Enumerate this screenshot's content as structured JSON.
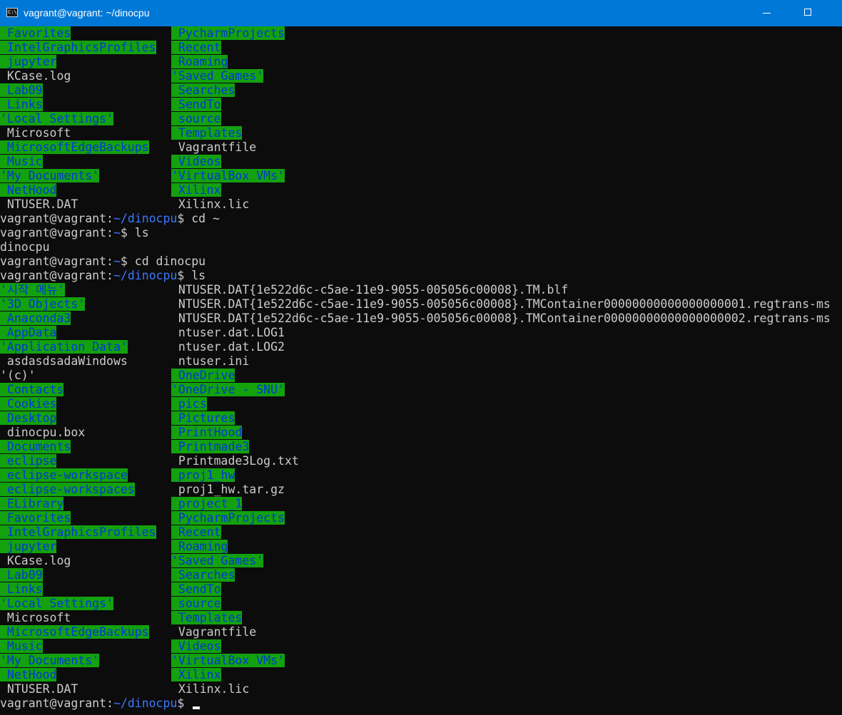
{
  "window": {
    "title": "vagrant@vagrant: ~/dinocpu",
    "icon": "command-prompt-icon",
    "icon_text": "C:\\",
    "controls": [
      "minimize-icon",
      "maximize-icon"
    ]
  },
  "colors": {
    "background": "#0c0c0c",
    "text": "#cccccc",
    "highlight_bg": "#13a10e",
    "highlight_text": "#0037da",
    "path": "#3b78ff",
    "titlebar": "#0078d7"
  },
  "listing_top": {
    "left": [
      {
        "t": " Favorites",
        "h": true
      },
      {
        "t": " IntelGraphicsProfiles",
        "h": true
      },
      {
        "t": " jupyter",
        "h": true
      },
      {
        "t": " KCase.log",
        "h": false
      },
      {
        "t": " Lab09",
        "h": true
      },
      {
        "t": " Links",
        "h": true
      },
      {
        "t": "'Local Settings'",
        "h": true
      },
      {
        "t": " Microsoft",
        "h": false
      },
      {
        "t": " MicrosoftEdgeBackups",
        "h": true
      },
      {
        "t": " Music",
        "h": true
      },
      {
        "t": "'My Documents'",
        "h": true
      },
      {
        "t": " NetHood",
        "h": true
      },
      {
        "t": " NTUSER.DAT",
        "h": false
      }
    ],
    "right": [
      {
        "t": " PycharmProjects",
        "h": true
      },
      {
        "t": " Recent",
        "h": true
      },
      {
        "t": " Roaming",
        "h": true
      },
      {
        "t": "'Saved Games'",
        "h": true
      },
      {
        "t": " Searches",
        "h": true
      },
      {
        "t": " SendTo",
        "h": true
      },
      {
        "t": " source",
        "h": true
      },
      {
        "t": " Templates",
        "h": true
      },
      {
        "t": " Vagrantfile",
        "h": false
      },
      {
        "t": " Videos",
        "h": true
      },
      {
        "t": "'VirtualBox VMs'",
        "h": true
      },
      {
        "t": " Xilinx",
        "h": true
      },
      {
        "t": " Xilinx.lic",
        "h": false
      }
    ]
  },
  "commands": [
    {
      "user": "vagrant@vagrant",
      "sep": ":",
      "path": "~/dinocpu",
      "cmd": "$ cd ~"
    },
    {
      "user": "vagrant@vagrant",
      "sep": ":",
      "path": "~",
      "cmd": "$ ls"
    },
    {
      "output": "dinocpu"
    },
    {
      "user": "vagrant@vagrant",
      "sep": ":",
      "path": "~",
      "cmd": "$ cd dinocpu"
    },
    {
      "user": "vagrant@vagrant",
      "sep": ":",
      "path": "~/dinocpu",
      "cmd": "$ ls"
    }
  ],
  "listing_bottom": {
    "left": [
      {
        "t": "'시작 메뉴'",
        "h": true
      },
      {
        "t": "'3D Objects'",
        "h": true
      },
      {
        "t": " Anaconda3",
        "h": true
      },
      {
        "t": " AppData",
        "h": true
      },
      {
        "t": "'Application Data'",
        "h": true
      },
      {
        "t": " asdasdsadaWindows",
        "h": false
      },
      {
        "t": "'(c)'",
        "h": false
      },
      {
        "t": " Contacts",
        "h": true
      },
      {
        "t": " Cookies",
        "h": true
      },
      {
        "t": " Desktop",
        "h": true
      },
      {
        "t": " dinocpu.box",
        "h": false
      },
      {
        "t": " Documents",
        "h": true
      },
      {
        "t": " eclipse",
        "h": true
      },
      {
        "t": " eclipse-workspace",
        "h": true
      },
      {
        "t": " eclipse-workspaces",
        "h": true
      },
      {
        "t": " ELibrary",
        "h": true
      },
      {
        "t": " Favorites",
        "h": true
      },
      {
        "t": " IntelGraphicsProfiles",
        "h": true
      },
      {
        "t": " jupyter",
        "h": true
      },
      {
        "t": " KCase.log",
        "h": false
      },
      {
        "t": " Lab09",
        "h": true
      },
      {
        "t": " Links",
        "h": true
      },
      {
        "t": "'Local Settings'",
        "h": true
      },
      {
        "t": " Microsoft",
        "h": false
      },
      {
        "t": " MicrosoftEdgeBackups",
        "h": true
      },
      {
        "t": " Music",
        "h": true
      },
      {
        "t": "'My Documents'",
        "h": true
      },
      {
        "t": " NetHood",
        "h": true
      },
      {
        "t": " NTUSER.DAT",
        "h": false
      }
    ],
    "right": [
      {
        "t": " NTUSER.DAT{1e522d6c-c5ae-11e9-9055-005056c00008}.TM.blf",
        "h": false
      },
      {
        "t": " NTUSER.DAT{1e522d6c-c5ae-11e9-9055-005056c00008}.TMContainer00000000000000000001.regtrans-ms",
        "h": false
      },
      {
        "t": " NTUSER.DAT{1e522d6c-c5ae-11e9-9055-005056c00008}.TMContainer00000000000000000002.regtrans-ms",
        "h": false
      },
      {
        "t": " ntuser.dat.LOG1",
        "h": false
      },
      {
        "t": " ntuser.dat.LOG2",
        "h": false
      },
      {
        "t": " ntuser.ini",
        "h": false
      },
      {
        "t": " OneDrive",
        "h": true
      },
      {
        "t": "'OneDrive - SNU'",
        "h": true
      },
      {
        "t": " pics",
        "h": true
      },
      {
        "t": " Pictures",
        "h": true
      },
      {
        "t": " PrintHood",
        "h": true
      },
      {
        "t": " Printmade3",
        "h": true
      },
      {
        "t": " Printmade3Log.txt",
        "h": false
      },
      {
        "t": " proj1_hw",
        "h": true
      },
      {
        "t": " proj1_hw.tar.gz",
        "h": false
      },
      {
        "t": " project_1",
        "h": true
      },
      {
        "t": " PycharmProjects",
        "h": true
      },
      {
        "t": " Recent",
        "h": true
      },
      {
        "t": " Roaming",
        "h": true
      },
      {
        "t": "'Saved Games'",
        "h": true
      },
      {
        "t": " Searches",
        "h": true
      },
      {
        "t": " SendTo",
        "h": true
      },
      {
        "t": " source",
        "h": true
      },
      {
        "t": " Templates",
        "h": true
      },
      {
        "t": " Vagrantfile",
        "h": false
      },
      {
        "t": " Videos",
        "h": true
      },
      {
        "t": "'VirtualBox VMs'",
        "h": true
      },
      {
        "t": " Xilinx",
        "h": true
      },
      {
        "t": " Xilinx.lic",
        "h": false
      }
    ]
  },
  "final_prompt": {
    "user": "vagrant@vagrant",
    "sep": ":",
    "path": "~/dinocpu",
    "cmd": "$ "
  }
}
